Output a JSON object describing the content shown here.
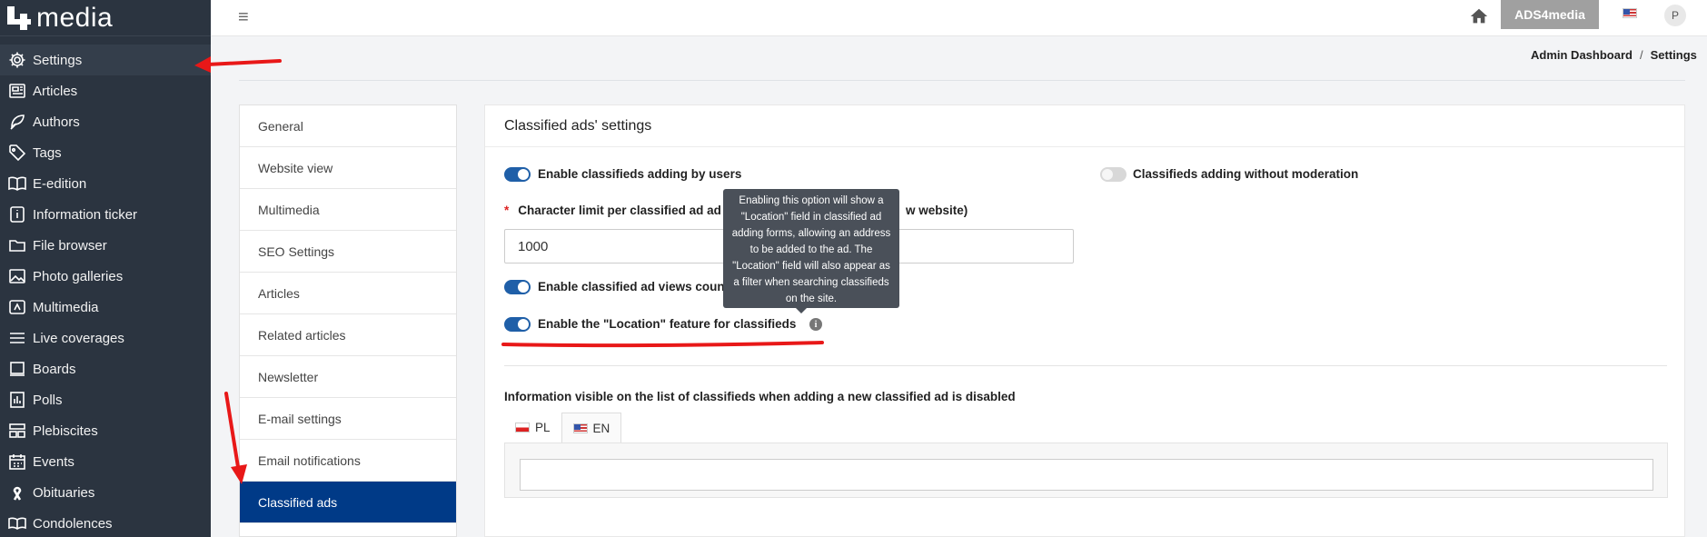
{
  "brand": {
    "mark": "4",
    "text": "media"
  },
  "sidebar": {
    "items": [
      {
        "label": "Settings",
        "icon": "gear-icon",
        "active": true
      },
      {
        "label": "Articles",
        "icon": "newspaper-icon"
      },
      {
        "label": "Authors",
        "icon": "feather-icon"
      },
      {
        "label": "Tags",
        "icon": "tag-icon"
      },
      {
        "label": "E-edition",
        "icon": "book-icon"
      },
      {
        "label": "Information ticker",
        "icon": "info-icon"
      },
      {
        "label": "File browser",
        "icon": "folder-icon"
      },
      {
        "label": "Photo galleries",
        "icon": "image-icon"
      },
      {
        "label": "Multimedia",
        "icon": "media-icon"
      },
      {
        "label": "Live coverages",
        "icon": "list-icon"
      },
      {
        "label": "Boards",
        "icon": "board-icon"
      },
      {
        "label": "Polls",
        "icon": "poll-icon"
      },
      {
        "label": "Plebiscites",
        "icon": "plebiscite-icon"
      },
      {
        "label": "Events",
        "icon": "calendar-icon"
      },
      {
        "label": "Obituaries",
        "icon": "ribbon-icon"
      },
      {
        "label": "Condolences",
        "icon": "book-open-icon"
      }
    ]
  },
  "topbar": {
    "menu_glyph": "≡",
    "site_button": "ADS4media",
    "avatar_initial": "P"
  },
  "breadcrumb": {
    "parent": "Admin Dashboard",
    "separator": "/",
    "current": "Settings"
  },
  "settings_menu": [
    "General",
    "Website view",
    "Multimedia",
    "SEO Settings",
    "Articles",
    "Related articles",
    "Newsletter",
    "E-mail settings",
    "Email notifications",
    "Classified ads"
  ],
  "panel": {
    "title": "Classified ads' settings",
    "opt_enable_adding": "Enable classifieds adding by users",
    "opt_without_moderation": "Classifieds adding without moderation",
    "char_limit_required": "*",
    "char_limit_label_a": "Character limit per classified ad ad",
    "char_limit_label_b": "w website)",
    "char_limit_value": "1000",
    "opt_views_counter": "Enable classified ad views coun",
    "opt_location": "Enable the \"Location\" feature for classifieds",
    "info_glyph": "i",
    "tooltip": "Enabling this option will show a \"Location\" field in classified ad adding forms, allowing an address to be added to the ad. The \"Location\" field will also appear as a filter when searching classifieds on the site.",
    "disabled_info_label": "Information visible on the list of classifieds when adding a new classified ad is disabled",
    "lang_tabs": [
      {
        "label": "PL"
      },
      {
        "label": "EN"
      }
    ]
  },
  "colors": {
    "sidebar_bg": "#2b3440",
    "active_menu": "#003a87",
    "toggle_on": "#1f5fa8",
    "annotation": "#e81818"
  }
}
